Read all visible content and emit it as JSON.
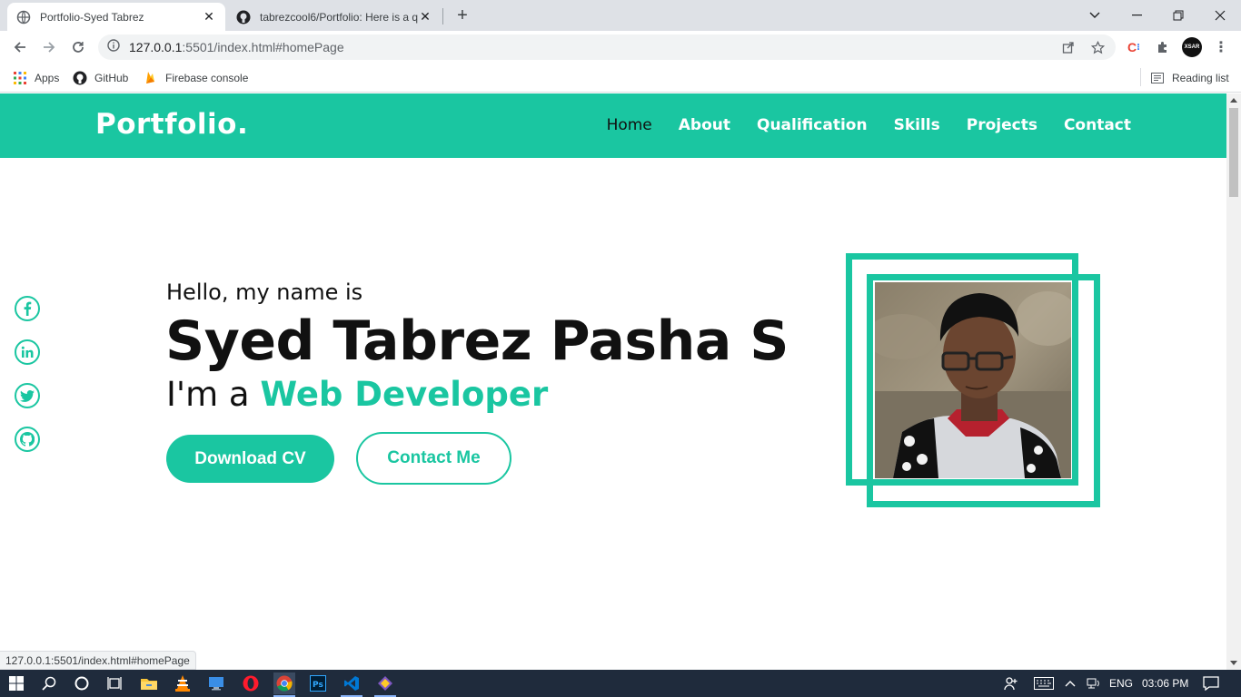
{
  "browser": {
    "tabs": [
      {
        "title": "Portfolio-Syed Tabrez",
        "close": "✕"
      },
      {
        "title": "tabrezcool6/Portfolio: Here is a q",
        "close": "✕"
      }
    ],
    "new_tab": "+",
    "url_host": "127.0.0.1",
    "url_path": ":5501/index.html#homePage",
    "bookmarks": [
      "Apps",
      "GitHub",
      "Firebase console"
    ],
    "reading_list": "Reading list",
    "profile_badge": "XSAR",
    "status_url": "127.0.0.1:5501/index.html#homePage"
  },
  "site": {
    "brand": "Portfolio.",
    "nav": [
      "Home",
      "About",
      "Qualification",
      "Skills",
      "Projects",
      "Contact"
    ],
    "active_nav": "Home",
    "hello": "Hello, my name is",
    "name": "Syed Tabrez Pasha S",
    "role_prefix": "I'm a ",
    "role": "Web Developer",
    "download_cv": "Download CV",
    "contact_me": "Contact Me",
    "social_icons": [
      "facebook-icon",
      "linkedin-icon",
      "twitter-icon",
      "github-icon"
    ],
    "accent_color": "#1ac6a1"
  },
  "taskbar": {
    "language": "ENG",
    "time": "03:06 PM"
  }
}
